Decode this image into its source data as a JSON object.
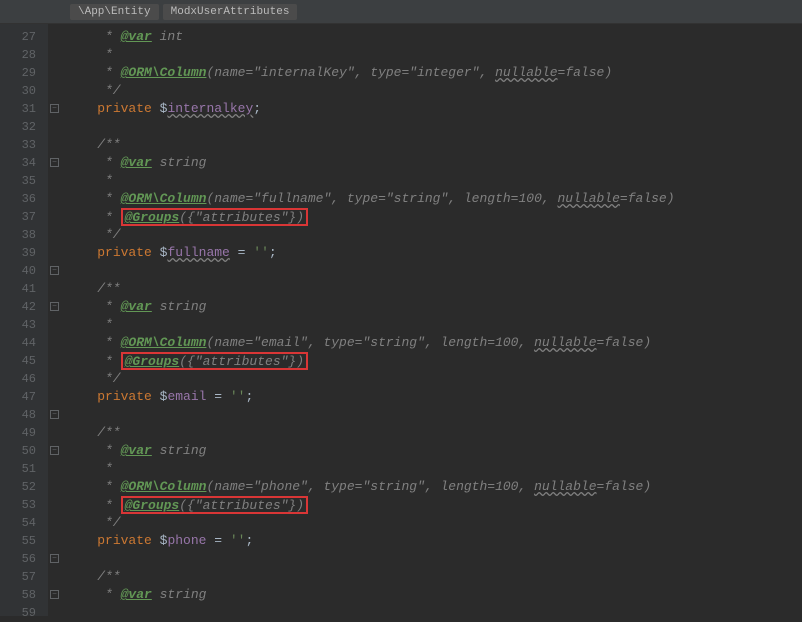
{
  "breadcrumb": {
    "namespace": "\\App\\Entity",
    "classname": "ModxUserAttributes"
  },
  "gutter": {
    "start": 27,
    "end": 59
  },
  "code": {
    "l27": {
      "prefix": " * ",
      "tag": "@var",
      "rest": " int"
    },
    "l28": {
      "text": " *"
    },
    "l29": {
      "prefix": " * ",
      "tag": "@ORM\\Column",
      "params": "(name=\"internalKey\", type=\"integer\", ",
      "nullable": "nullable",
      "suffix": "=false)"
    },
    "l30": {
      "text": " */"
    },
    "l31": {
      "kw": "private",
      "var": "$",
      "prop": "internalkey",
      "end": ";"
    },
    "l33": {
      "text": "/**"
    },
    "l34": {
      "prefix": " * ",
      "tag": "@var",
      "rest": " string"
    },
    "l35": {
      "text": " *"
    },
    "l36": {
      "prefix": " * ",
      "tag": "@ORM\\Column",
      "params": "(name=\"fullname\", type=\"string\", length=100, ",
      "nullable": "nullable",
      "suffix": "=false)"
    },
    "l37": {
      "prefix": " * ",
      "tag": "@Groups",
      "params": "({\"attributes\"})"
    },
    "l38": {
      "text": " */"
    },
    "l39": {
      "kw": "private",
      "var": "$",
      "prop": "fullname",
      "eq": " = ",
      "val": "''",
      "end": ";"
    },
    "l41": {
      "text": "/**"
    },
    "l42": {
      "prefix": " * ",
      "tag": "@var",
      "rest": " string"
    },
    "l43": {
      "text": " *"
    },
    "l44": {
      "prefix": " * ",
      "tag": "@ORM\\Column",
      "params": "(name=\"email\", type=\"string\", length=100, ",
      "nullable": "nullable",
      "suffix": "=false)"
    },
    "l45": {
      "prefix": " * ",
      "tag": "@Groups",
      "params": "({\"attributes\"})"
    },
    "l46": {
      "text": " */"
    },
    "l47": {
      "kw": "private",
      "var": "$",
      "prop": "email",
      "eq": " = ",
      "val": "''",
      "end": ";"
    },
    "l49": {
      "text": "/**"
    },
    "l50": {
      "prefix": " * ",
      "tag": "@var",
      "rest": " string"
    },
    "l51": {
      "text": " *"
    },
    "l52": {
      "prefix": " * ",
      "tag": "@ORM\\Column",
      "params": "(name=\"phone\", type=\"string\", length=100, ",
      "nullable": "nullable",
      "suffix": "=false)"
    },
    "l53": {
      "prefix": " * ",
      "tag": "@Groups",
      "params": "({\"attributes\"})"
    },
    "l54": {
      "text": " */"
    },
    "l55": {
      "kw": "private",
      "var": "$",
      "prop": "phone",
      "eq": " = ",
      "val": "''",
      "end": ";"
    },
    "l57": {
      "text": "/**"
    },
    "l58": {
      "prefix": " * ",
      "tag": "@var",
      "rest": " string"
    }
  },
  "fold_markers": [
    {
      "line": 31,
      "sym": "−"
    },
    {
      "line": 34,
      "sym": "−"
    },
    {
      "line": 40,
      "sym": "−"
    },
    {
      "line": 42,
      "sym": "−"
    },
    {
      "line": 48,
      "sym": "−"
    },
    {
      "line": 50,
      "sym": "−"
    },
    {
      "line": 56,
      "sym": "−"
    },
    {
      "line": 58,
      "sym": "−"
    }
  ]
}
